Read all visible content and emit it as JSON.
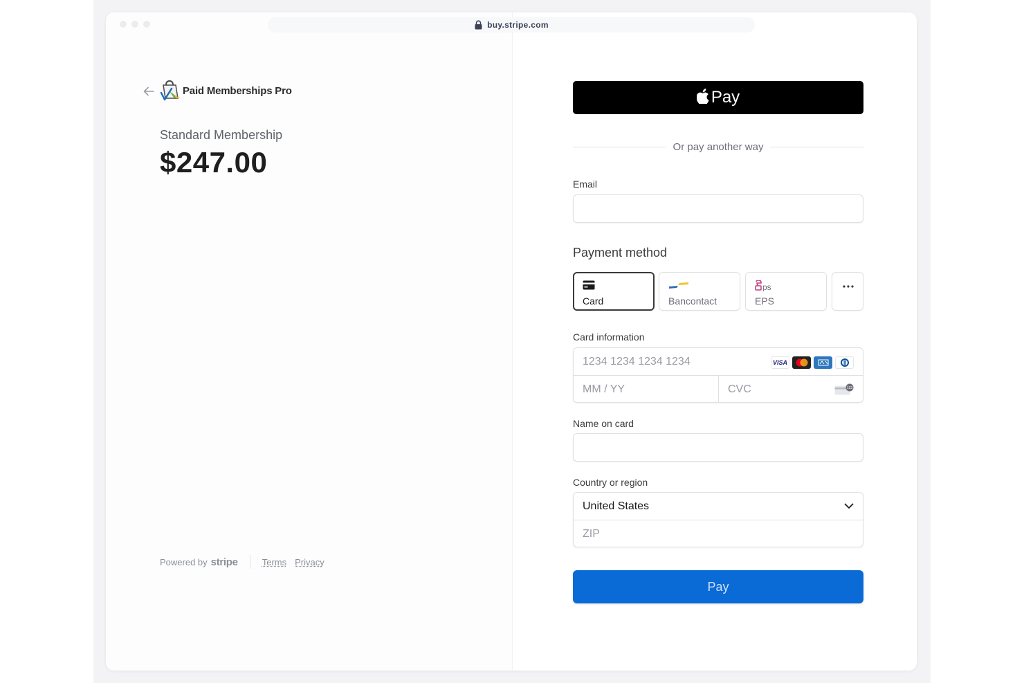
{
  "browser": {
    "url": "buy.stripe.com"
  },
  "merchant": {
    "name": "Paid Memberships Pro",
    "product": "Standard Membership",
    "price": "$247.00"
  },
  "footer": {
    "powered_by": "Powered by",
    "stripe": "stripe",
    "terms": "Terms",
    "privacy": "Privacy"
  },
  "checkout": {
    "apple_pay_label": "Pay",
    "divider_text": "Or pay another way",
    "email_label": "Email",
    "email_value": "",
    "payment_method_title": "Payment method",
    "payment_methods": [
      {
        "label": "Card",
        "icon": "card-icon",
        "selected": true
      },
      {
        "label": "Bancontact",
        "icon": "bancontact-icon",
        "selected": false
      },
      {
        "label": "EPS",
        "icon": "eps-icon",
        "selected": false
      }
    ],
    "more_methods_icon": "more-icon",
    "card_info_label": "Card information",
    "card_number_placeholder": "1234 1234 1234 1234",
    "card_brands": [
      "VISA",
      "Mastercard",
      "American Express",
      "Diners Club"
    ],
    "expiry_placeholder": "MM / YY",
    "cvc_placeholder": "CVC",
    "name_label": "Name on card",
    "name_value": "",
    "country_label": "Country or region",
    "country_value": "United States",
    "zip_placeholder": "ZIP",
    "pay_label": "Pay"
  },
  "colors": {
    "pay_button": "#0a6ad6",
    "apple_pay_button": "#000000",
    "selected_tab_border": "#3a3a3a"
  }
}
